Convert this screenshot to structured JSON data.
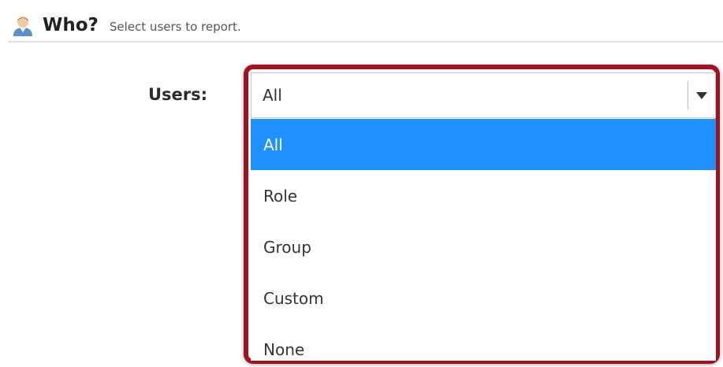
{
  "header": {
    "icon": "user-icon",
    "title": "Who?",
    "subtitle": "Select users to report."
  },
  "form": {
    "users_label": "Users:",
    "users_select": {
      "value": "All",
      "arrow_icon": "triangle-down-icon",
      "options": [
        {
          "label": "All",
          "selected": true
        },
        {
          "label": "Role",
          "selected": false
        },
        {
          "label": "Group",
          "selected": false
        },
        {
          "label": "Custom",
          "selected": false
        },
        {
          "label": "None",
          "selected": false
        }
      ]
    }
  },
  "colors": {
    "highlight_border": "#a3111e",
    "selected_option_bg": "#1e90ff",
    "selected_option_text": "#ffffff"
  }
}
